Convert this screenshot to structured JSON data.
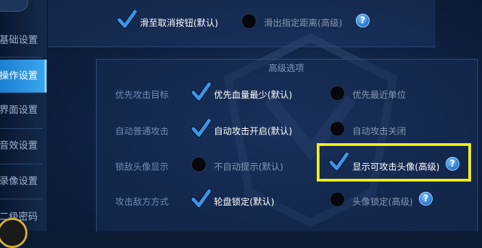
{
  "sidebar": {
    "items": [
      {
        "label": "基础设置",
        "active": false
      },
      {
        "label": "操作设置",
        "active": true
      },
      {
        "label": "界面设置",
        "active": false
      },
      {
        "label": "音效设置",
        "active": false
      },
      {
        "label": "录像设置",
        "active": false
      },
      {
        "label": "二级密码",
        "active": false
      }
    ]
  },
  "top_options": [
    {
      "label": "滑至取消按钮(默认)",
      "selected": true
    },
    {
      "label": "滑出指定距离(高级)",
      "selected": false,
      "help": "?"
    }
  ],
  "advanced": {
    "title": "高级选项",
    "rows": [
      {
        "label": "优先攻击目标",
        "options": [
          {
            "label": "优先血量最少(默认)",
            "selected": true
          },
          {
            "label": "优先最近单位",
            "selected": false
          }
        ]
      },
      {
        "label": "自动普通攻击",
        "options": [
          {
            "label": "自动攻击开启(默认)",
            "selected": true
          },
          {
            "label": "自动攻击关闭",
            "selected": false
          }
        ]
      },
      {
        "label": "锁敌头像显示",
        "options": [
          {
            "label": "不自动提示(默认)",
            "selected": false
          },
          {
            "label": "显示可攻击头像(高级)",
            "selected": true,
            "help": "?"
          }
        ]
      },
      {
        "label": "攻击敌方方式",
        "options": [
          {
            "label": "轮盘锁定(默认)",
            "selected": true
          },
          {
            "label": "头像锁定(高级)",
            "selected": false,
            "help": "?"
          }
        ]
      }
    ]
  },
  "colors": {
    "accent": "#3aa7f0",
    "highlight": "#f1ee19",
    "check": "#3d95e6"
  }
}
